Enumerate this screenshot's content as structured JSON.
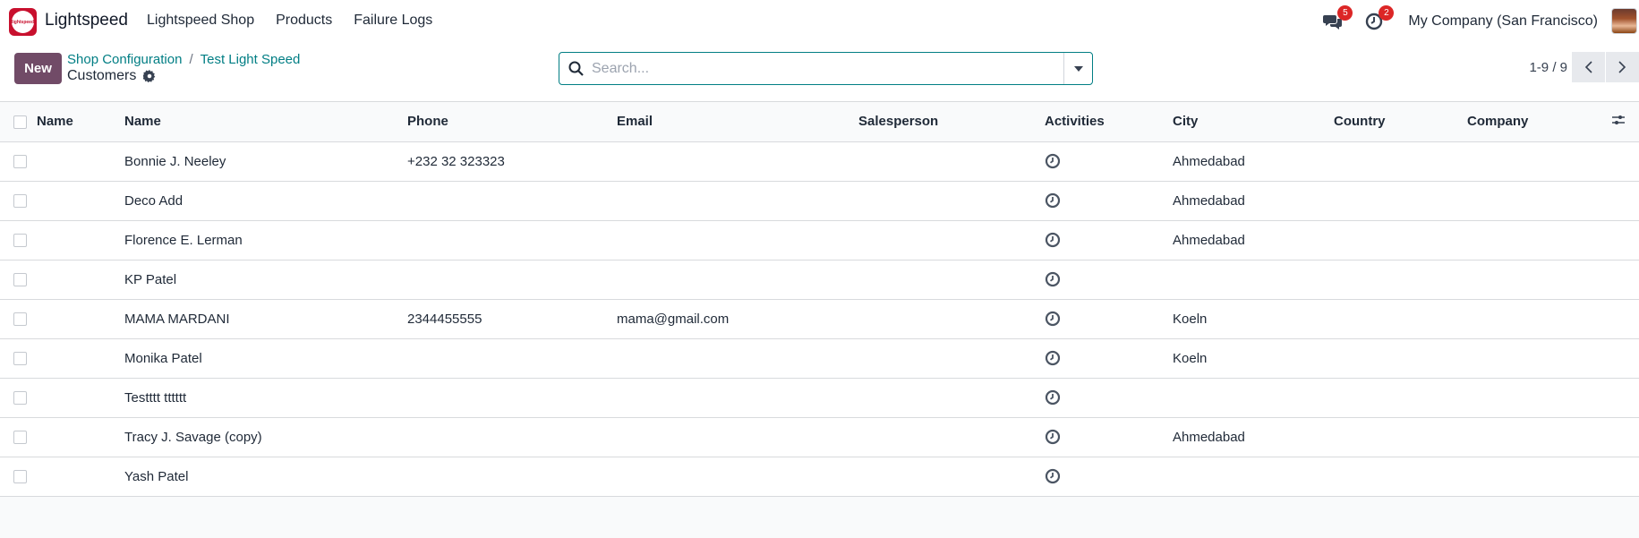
{
  "navbar": {
    "app_name": "Lightspeed",
    "logo_text": "lightspeed",
    "menu": [
      "Lightspeed Shop",
      "Products",
      "Failure Logs"
    ],
    "messages_count": "5",
    "activities_count": "2",
    "company": "My Company (San Francisco)"
  },
  "control": {
    "new_label": "New",
    "breadcrumb": [
      "Shop Configuration",
      "Test Light Speed"
    ],
    "breadcrumb_sep": "/",
    "page_title": "Customers",
    "search_placeholder": "Search...",
    "pager": "1-9 / 9"
  },
  "table": {
    "columns": [
      "Name",
      "Name",
      "Phone",
      "Email",
      "Salesperson",
      "Activities",
      "City",
      "Country",
      "Company"
    ],
    "rows": [
      {
        "name": "Bonnie J. Neeley",
        "phone": "+232 32 323323",
        "email": "",
        "city": "Ahmedabad"
      },
      {
        "name": "Deco Add",
        "phone": "",
        "email": "",
        "city": "Ahmedabad"
      },
      {
        "name": "Florence E. Lerman",
        "phone": "",
        "email": "",
        "city": "Ahmedabad"
      },
      {
        "name": "KP Patel",
        "phone": "",
        "email": "",
        "city": ""
      },
      {
        "name": "MAMA MARDANI",
        "phone": "2344455555",
        "email": "mama@gmail.com",
        "city": "Koeln"
      },
      {
        "name": "Monika Patel",
        "phone": "",
        "email": "",
        "city": "Koeln"
      },
      {
        "name": "Testttt tttttt",
        "phone": "",
        "email": "",
        "city": ""
      },
      {
        "name": "Tracy J. Savage (copy)",
        "phone": "",
        "email": "",
        "city": "Ahmedabad"
      },
      {
        "name": "Yash Patel",
        "phone": "",
        "email": "",
        "city": ""
      }
    ]
  },
  "colors": {
    "primary": "#714b67",
    "link": "#017e84",
    "badge": "#dc2626"
  }
}
